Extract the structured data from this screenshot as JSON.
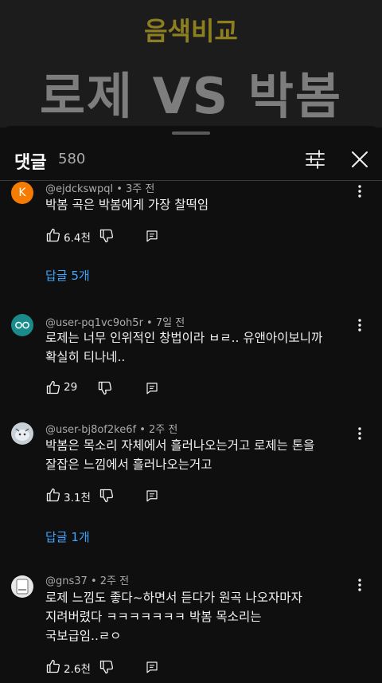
{
  "video": {
    "subtitle": "음색비교",
    "title": "로제 VS 박봄"
  },
  "comments_panel": {
    "title": "댓글",
    "count": "580"
  },
  "comments": [
    {
      "author": "@ejdckswpql",
      "separator": " • ",
      "time": "3주 전",
      "avatar_letter": "K",
      "text": "박봄 곡은 박봄에게 가장 찰떡임",
      "likes": "6.4천",
      "replies_label": "답글 5개"
    },
    {
      "author": "@user-pq1vc9oh5r",
      "separator": " • ",
      "time": "7일 전",
      "text_line1": "로제는 너무 인위적인 창법이라  ㅂㄹ.. 유앤아이보니까",
      "text_line2": "확실히 티나네..",
      "likes": "29"
    },
    {
      "author": "@user-bj8of2ke6f",
      "separator": " • ",
      "time": "2주 전",
      "text_line1": "박봄은 목소리 자체에서 흘러나오는거고 로제는 톤을",
      "text_line2": "잘잡은 느낌에서 흘러나오는거고",
      "likes": "3.1천",
      "replies_label": "답글 1개"
    },
    {
      "author": "@gns37",
      "separator": " • ",
      "time": "2주 전",
      "text_line1": "로제 느낌도 좋다~하면서 듣다가 원곡 나오자마자",
      "text_line2": "지려버렸다 ㅋㅋㅋㅋㅋㅋㅋ 박봄 목소리는",
      "text_line3": "국보급임..ㄹㅇ",
      "likes": "2.6천"
    }
  ],
  "colors": {
    "accent_link": "#3ea6ff",
    "avatar_k": "#f57c00",
    "avatar_teal": "#1a8a8a"
  }
}
